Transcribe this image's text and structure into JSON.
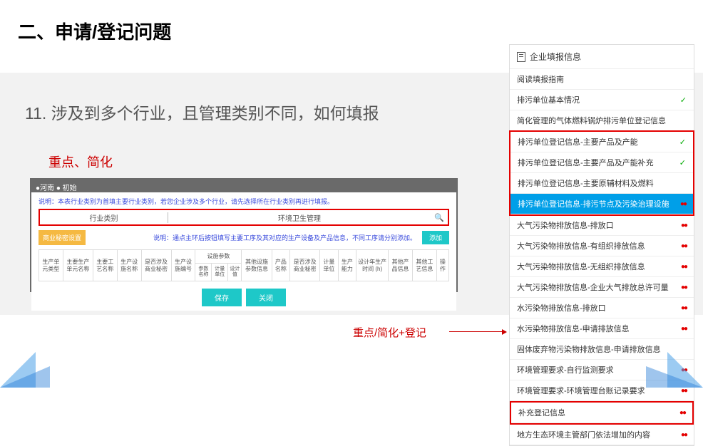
{
  "title": "二、申请/登记问题",
  "question": "11. 涉及到多个行业，且管理类别不同，如何填报",
  "anno_top": "重点、简化",
  "anno_bottom": "重点/简化+登记",
  "app": {
    "title": "●河南  ● 初始",
    "hint1": "说明：本表行业类别为首填主要行业类别，若您企业涉及多个行业，请先选择所在行业类别再进行填报。",
    "row_label": "行业类别",
    "row_value": "环境卫生管理",
    "biz_btn": "商业秘密设置",
    "hint2": "说明：通点主环后按钮填写主要工序及其对应的生产设备及产品信息，不同工序请分别添加。",
    "add_btn": "添加",
    "save": "保存",
    "close": "关闭",
    "headers_top": [
      "生产单元类型",
      "主要生产单元名称",
      "主要工艺名称",
      "生产设施名称",
      "是否涉及商业秘密",
      "生产设施编号",
      "设施参数",
      "其他设施参数信息",
      "产品名称",
      "是否涉及商业秘密",
      "计量单位",
      "生产能力",
      "设计年生产时间 (h)",
      "其他产品信息",
      "其他工艺信息",
      "操作"
    ],
    "headers_sub": [
      "参数名称",
      "计量单位",
      "设计值"
    ]
  },
  "panel": {
    "head": "企业填报信息",
    "items": [
      {
        "t": "阅读填报指南",
        "m": ""
      },
      {
        "t": "排污单位基本情况",
        "m": "chk"
      },
      {
        "t": "简化管理的气体燃料锅炉排污单位登记信息",
        "m": ""
      },
      {
        "t": "排污单位登记信息-主要产品及产能",
        "m": "chk",
        "g": "a"
      },
      {
        "t": "排污单位登记信息-主要产品及产能补充",
        "m": "chk",
        "g": "a"
      },
      {
        "t": "排污单位登记信息-主要原辅材料及燃料",
        "m": "",
        "g": "a"
      },
      {
        "t": "排污单位登记信息-排污节点及污染治理设施",
        "m": "dts",
        "g": "a",
        "active": true
      },
      {
        "t": "大气污染物排放信息-排放口",
        "m": "dts"
      },
      {
        "t": "大气污染物排放信息-有组织排放信息",
        "m": "dts"
      },
      {
        "t": "大气污染物排放信息-无组织排放信息",
        "m": "dts"
      },
      {
        "t": "大气污染物排放信息-企业大气排放总许可量",
        "m": "dts"
      },
      {
        "t": "水污染物排放信息-排放口",
        "m": "dts"
      },
      {
        "t": "水污染物排放信息-申请排放信息",
        "m": "dts"
      },
      {
        "t": "固体废弃物污染物排放信息-申请排放信息",
        "m": ""
      },
      {
        "t": "环境管理要求-自行监测要求",
        "m": "dts"
      },
      {
        "t": "环境管理要求-环境管理台账记录要求",
        "m": "dts"
      },
      {
        "t": "补充登记信息",
        "m": "dts",
        "g": "b"
      },
      {
        "t": "地方生态环境主管部门依法增加的内容",
        "m": "dts"
      }
    ]
  }
}
